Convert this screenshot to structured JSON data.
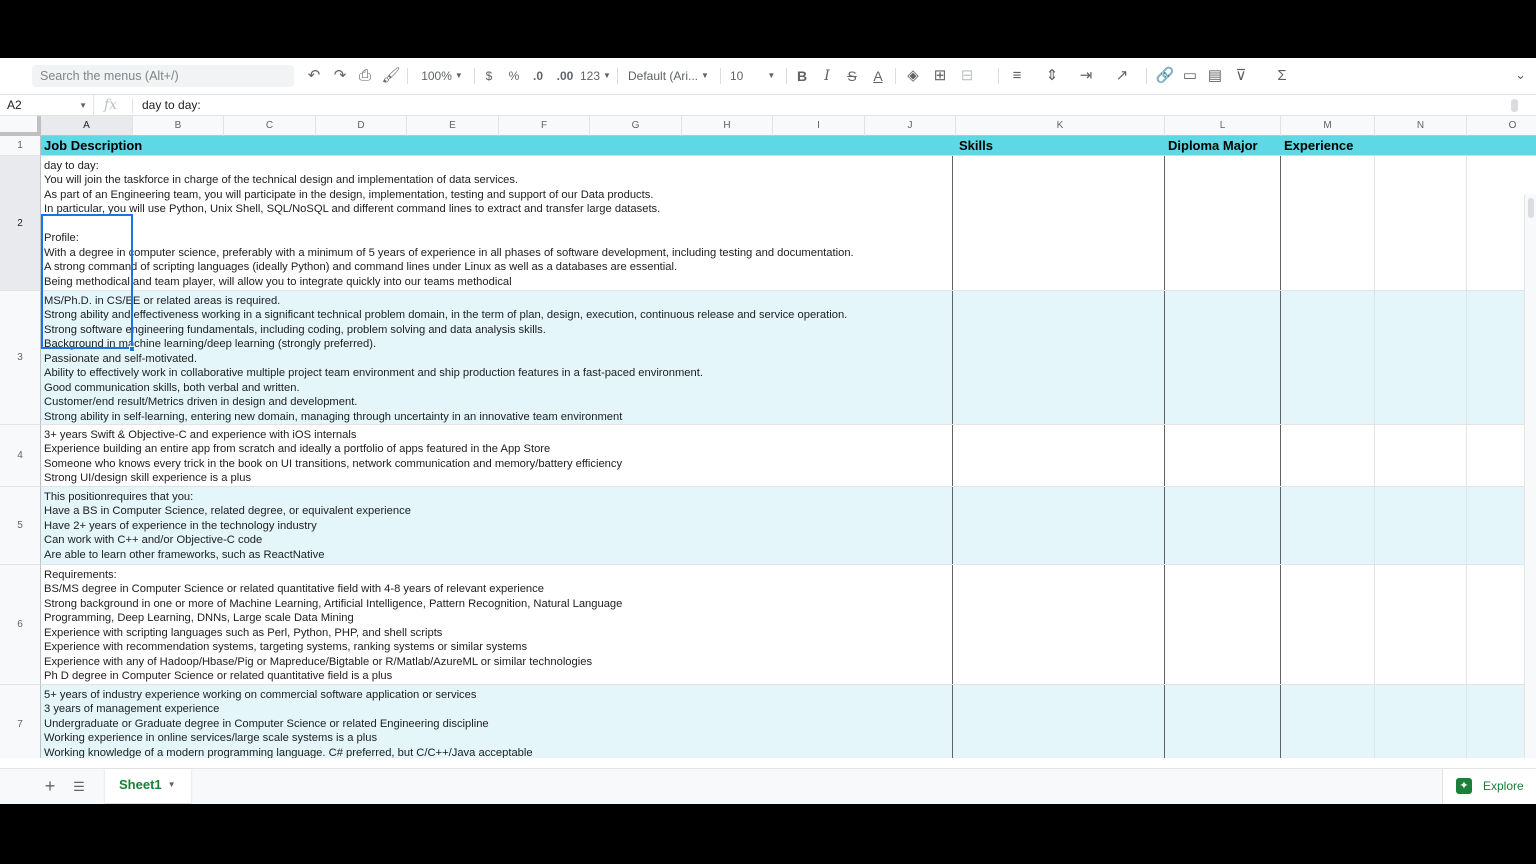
{
  "toolbar": {
    "search_placeholder": "Search the menus (Alt+/)",
    "zoom": "100%",
    "currency": "$",
    "percent": "%",
    "dec_decrease": ".0",
    "dec_increase": ".00",
    "more_formats": "123",
    "font": "Default (Ari...",
    "font_size": "10"
  },
  "formula_bar": {
    "cell_ref": "A2",
    "content": "day to day:"
  },
  "columns": [
    "A",
    "B",
    "C",
    "D",
    "E",
    "F",
    "G",
    "H",
    "I",
    "J",
    "K",
    "L",
    "M",
    "N",
    "O"
  ],
  "rows": [
    "1",
    "2",
    "3",
    "4",
    "5",
    "6",
    "7"
  ],
  "header_row": {
    "job_description": "Job Description",
    "skills": "Skills",
    "diploma_major": "Diploma Major",
    "experience": "Experience"
  },
  "job_descriptions": [
    [
      "day to day:",
      "You will join the taskforce in charge of the technical design and implementation of data services.",
      "As part of an Engineering team, you will participate in the design, implementation, testing and support of our Data products.",
      "In particular, you will use Python, Unix Shell, SQL/NoSQL and different command lines to extract and transfer large datasets.",
      "",
      "Profile:",
      "With a degree in computer science, preferably with a minimum of 5 years of experience in all phases of software development, including testing and documentation.",
      "A strong command of scripting languages (ideally Python) and command lines under Linux as well as a databases are essential.",
      "Being methodical and team player, will allow you to integrate quickly into our teams methodical"
    ],
    [
      "MS/Ph.D. in CS/EE or related areas is required.",
      "Strong ability and effectiveness working in a significant technical problem domain, in the term of plan, design, execution, continuous release and service operation.",
      "Strong software engineering fundamentals, including coding, problem solving and data analysis skills.",
      "Background in machine learning/deep learning (strongly preferred).",
      "Passionate and self-motivated.",
      "Ability to effectively work in collaborative multiple project team environment and ship production features in a fast-paced environment.",
      "Good communication skills, both verbal and written.",
      "Customer/end result/Metrics driven in design and development.",
      "Strong ability in self-learning, entering new domain, managing through uncertainty in an innovative team environment"
    ],
    [
      "3+ years Swift & Objective-C and experience with iOS internals",
      "Experience building an entire app from scratch and ideally a portfolio of apps featured in the App Store",
      "Someone who knows every trick in the book on UI transitions, network communication and memory/battery efficiency",
      "Strong UI/design skill experience is a plus"
    ],
    [
      "This positionrequires that you:",
      "Have a BS in Computer Science, related degree, or equivalent experience",
      "Have 2+ years of experience in the technology industry",
      "Can work with C++ and/or Objective-C code",
      "Are able to learn other frameworks, such as ReactNative"
    ],
    [
      "Requirements:",
      "BS/MS degree in Computer Science or related quantitative field with 4-8 years of relevant experience",
      "Strong background in one or more of Machine Learning, Artificial Intelligence, Pattern Recognition, Natural Language",
      "Programming, Deep Learning, DNNs, Large scale Data Mining",
      "Experience with scripting languages such as Perl, Python, PHP, and shell scripts",
      "Experience with recommendation systems, targeting systems, ranking systems or similar systems",
      "Experience with any of Hadoop/Hbase/Pig or Mapreduce/Bigtable or R/Matlab/AzureML or similar technologies",
      "Ph D degree in Computer Science or related quantitative field is a plus"
    ],
    [
      "5+ years of industry experience working on commercial software application or services",
      "3 years of management experience",
      "Undergraduate or Graduate degree in Computer Science or related Engineering discipline",
      "Working experience in online services/large scale systems is a plus",
      "Working knowledge of a modern programming language. C# preferred, but C/C++/Java acceptable"
    ]
  ],
  "sheet_tab": "Sheet1",
  "explore_label": "Explore",
  "colors": {
    "header_fill": "#5ed8e5",
    "alt_row_fill": "#e4f6f9",
    "selection": "#1a73e8",
    "sheet_tab_text": "#188038"
  }
}
